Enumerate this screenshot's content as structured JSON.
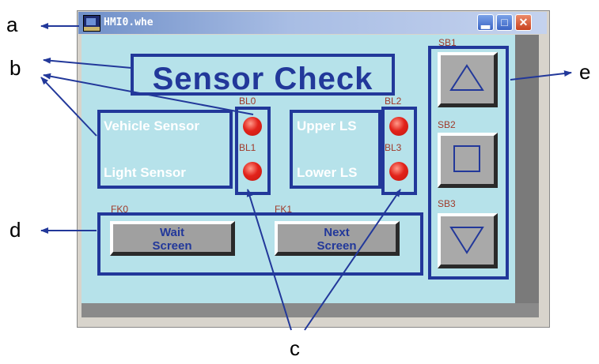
{
  "window": {
    "title": "HMI0.whe"
  },
  "panel": {
    "heading": "Sensor Check",
    "sensors_left": [
      "Vehicle Sensor",
      "Light Sensor"
    ],
    "sensors_right": [
      "Upper LS",
      "Lower LS"
    ],
    "lamps": [
      {
        "tag": "BL0",
        "state": "on",
        "color": "#e2231b"
      },
      {
        "tag": "BL1",
        "state": "on",
        "color": "#e2231b"
      },
      {
        "tag": "BL2",
        "state": "on",
        "color": "#e2231b"
      },
      {
        "tag": "BL3",
        "state": "on",
        "color": "#e2231b"
      }
    ],
    "function_keys": [
      {
        "tag": "FK0",
        "label_line1": "Wait",
        "label_line2": "Screen"
      },
      {
        "tag": "FK1",
        "label_line1": "Next",
        "label_line2": "Screen"
      }
    ],
    "side_buttons": [
      {
        "tag": "SB1",
        "icon": "up-triangle-icon"
      },
      {
        "tag": "SB2",
        "icon": "square-icon"
      },
      {
        "tag": "SB3",
        "icon": "down-triangle-icon"
      }
    ]
  },
  "callouts": {
    "a": "a",
    "b": "b",
    "c": "c",
    "d": "d",
    "e": "e"
  },
  "colors": {
    "outline": "#22389a",
    "panel_bg": "#b6e2ea",
    "lamp_red": "#e2231b",
    "tag_text": "#a03a2a"
  }
}
